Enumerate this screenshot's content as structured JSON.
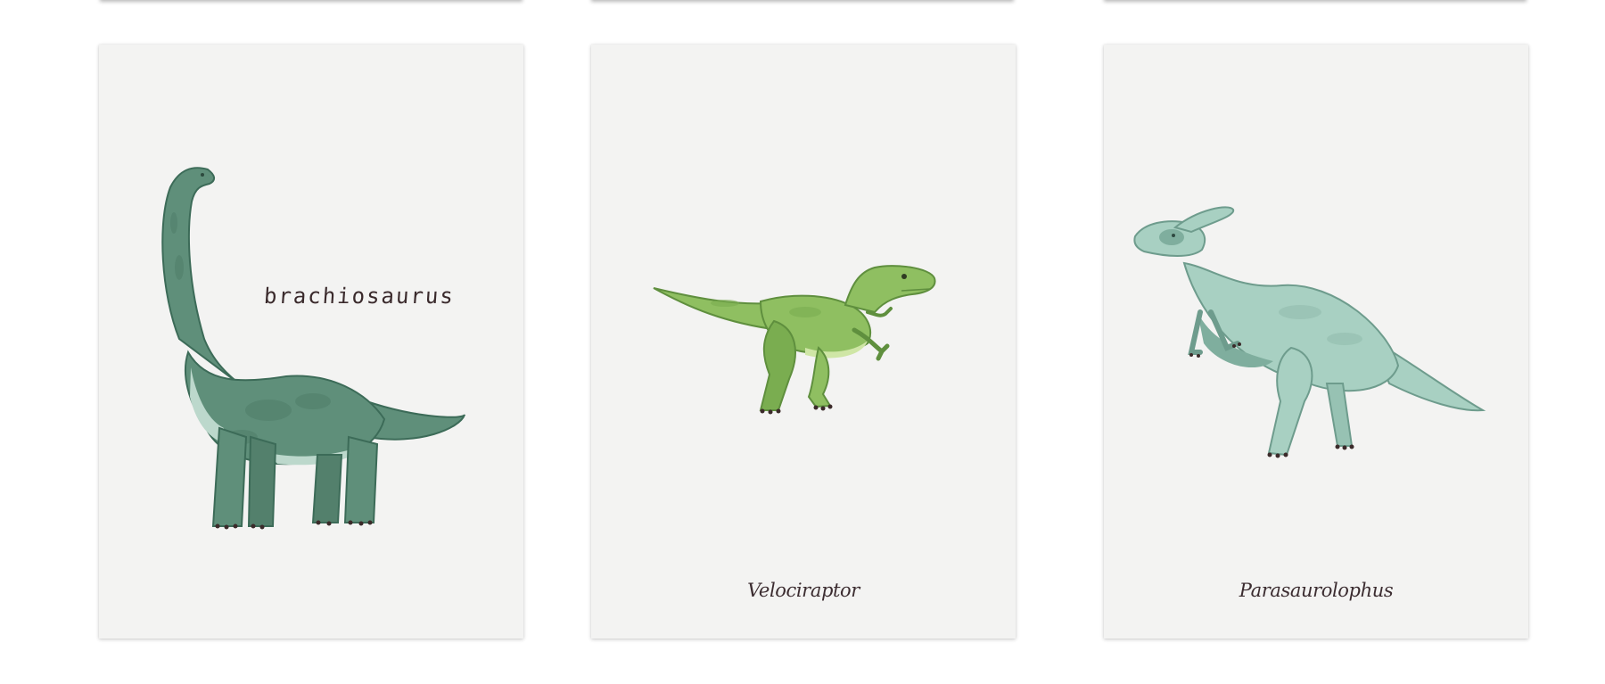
{
  "gallery": {
    "cards": [
      {
        "label": "brachiosaurus",
        "colors": {
          "body": "#5f8f7a",
          "belly": "#bcd8cc",
          "outline": "#3c6b58",
          "label": "#3a2a2c"
        }
      },
      {
        "label": "Velociraptor",
        "colors": {
          "body": "#8fbf61",
          "belly": "#cfe6a6",
          "outline": "#5f8f3e",
          "label": "#3b2c30"
        }
      },
      {
        "label": "Parasaurolophus",
        "colors": {
          "body": "#a8d0c2",
          "belly": "#7fae9e",
          "outline": "#6e9c8d",
          "label": "#3b2c30"
        }
      }
    ]
  }
}
